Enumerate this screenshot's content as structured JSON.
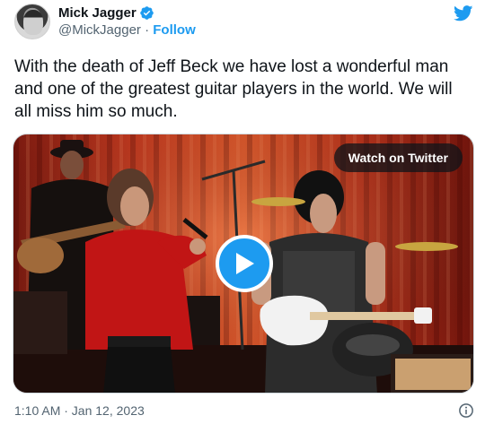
{
  "author": {
    "display_name": "Mick Jagger",
    "handle": "@MickJagger",
    "separator": "·",
    "follow_label": "Follow",
    "verified": true
  },
  "tweet": {
    "text": "With the death of Jeff Beck we have lost a wonderful man and one of the greatest guitar players in the world. We will all miss him so much.",
    "timestamp": "1:10 AM · Jan 12, 2023"
  },
  "media": {
    "watch_label": "Watch on Twitter",
    "type": "video"
  },
  "icons": {
    "brand": "twitter-bird-icon",
    "info": "info-icon",
    "play": "play-icon",
    "verified": "verified-badge-icon"
  },
  "colors": {
    "accent": "#1d9bf0",
    "text": "#0f1419",
    "secondary": "#536471"
  }
}
